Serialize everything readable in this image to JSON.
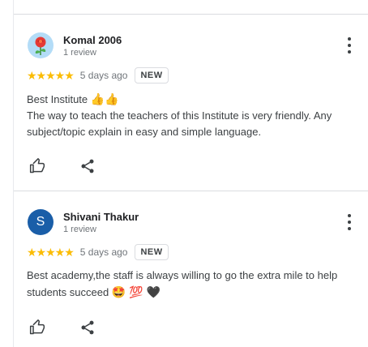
{
  "reviews": [
    {
      "name": "Komal 2006",
      "review_count": "1 review",
      "stars": "★★★★★",
      "time": "5 days ago",
      "badge": "NEW",
      "avatar_kind": "image",
      "title": "Best Institute",
      "title_emoji": "👍👍",
      "text": "The way to teach the teachers of this Institute is very friendly. Any subject/topic explain in easy and simple language."
    },
    {
      "name": "Shivani Thakur",
      "review_count": "1 review",
      "stars": "★★★★★",
      "time": "5 days ago",
      "badge": "NEW",
      "avatar_kind": "letter",
      "avatar_letter": "S",
      "text": "Best academy,the staff is always willing to go the extra mile to help students succeed",
      "text_emoji": "🤩 💯 🖤"
    }
  ],
  "icons": {
    "like": "thumbs-up-icon",
    "share": "share-icon",
    "menu": "more-vert-icon"
  },
  "colors": {
    "stars": "#fbbc04",
    "avatar_letter_bg": "#1a5ea8",
    "avatar_image_bg": "#b3dcf7"
  }
}
